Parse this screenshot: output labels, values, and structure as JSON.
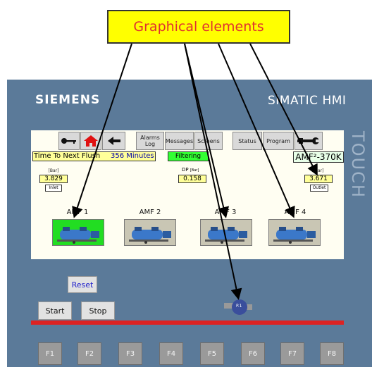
{
  "callout": {
    "text": "Graphical elements"
  },
  "hmi": {
    "brand": "SIEMENS",
    "model": "SIMATIC HMI",
    "side_text": "TOUCH"
  },
  "toolbar": {
    "alarms_log": "Alarms Log",
    "messages": "Messages",
    "screens": "Screens",
    "status": "Status",
    "program": "Program"
  },
  "header": {
    "flush_label": "Time To Next Flush",
    "flush_value": "356 Minutes",
    "status": "Filtering",
    "unit_name": "AMF²-370K"
  },
  "inlet": {
    "unit": "[Bar]",
    "value": "3.829",
    "label": "Inlet"
  },
  "dp": {
    "label": "DP",
    "unit": "[Bar]",
    "value": "0.158"
  },
  "outlet": {
    "unit": "[Bar]",
    "value": "3.671",
    "label": "Outlet"
  },
  "amfs": [
    {
      "label": "AMF 1",
      "active": true
    },
    {
      "label": "AMF 2",
      "active": false
    },
    {
      "label": "AMF 3",
      "active": false
    },
    {
      "label": "AMF 4",
      "active": false
    }
  ],
  "buttons": {
    "reset": "Reset",
    "start": "Start",
    "stop": "Stop"
  },
  "pump": {
    "label": "P.1"
  },
  "fkeys": [
    "F1",
    "F2",
    "F3",
    "F4",
    "F5",
    "F6",
    "F7",
    "F8"
  ],
  "colors": {
    "callout_bg": "#ffff00",
    "callout_text": "#e03030",
    "active_amf": "#22dd22",
    "inactive_amf": "#c9c6b4",
    "status_green": "#33ff33",
    "bottom_bar": "#dd2222",
    "frame": "#5b7a99"
  }
}
